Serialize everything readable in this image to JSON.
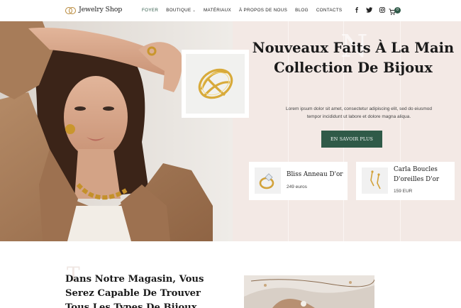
{
  "header": {
    "brand": "Jewelry Shop",
    "nav": [
      {
        "label": "FOYER",
        "active": true
      },
      {
        "label": "BOUTIQUE",
        "dropdown": true
      },
      {
        "label": "MATÉRIAUX"
      },
      {
        "label": "À PROPOS DE NOUS"
      },
      {
        "label": "BLOG"
      },
      {
        "label": "CONTACTS"
      }
    ],
    "social": [
      "facebook-icon",
      "twitter-icon",
      "instagram-icon"
    ],
    "cart_count": "0"
  },
  "hero": {
    "ghost_letter": "N",
    "title_line1": "Nouveaux Faits À La Main",
    "title_line2": "Collection De Bijoux",
    "text_line1": "Lorem ipsum dolor sit amet, consectetur adipiscing elit, sed do eiusmod",
    "text_line2": "tempor incididunt ut labore et dolore magna aliqua.",
    "cta_label": "EN SAVOIR PLUS"
  },
  "products": [
    {
      "name": "Bliss Anneau D'or",
      "price": "249 euros"
    },
    {
      "name_line1": "Carla Boucles",
      "name_line2": "D'oreilles D'or",
      "price": "159 EUR"
    }
  ],
  "section2": {
    "ghost_letter": "T",
    "title_line1": "Dans Notre Magasin, Vous",
    "title_line2": "Serez Capable De Trouver",
    "title_line3": "Tous Les Types De Bijoux"
  },
  "colors": {
    "accent": "#2f5a48",
    "hero_bg": "#f3e9e5",
    "logo_gold": "#b8893a"
  }
}
